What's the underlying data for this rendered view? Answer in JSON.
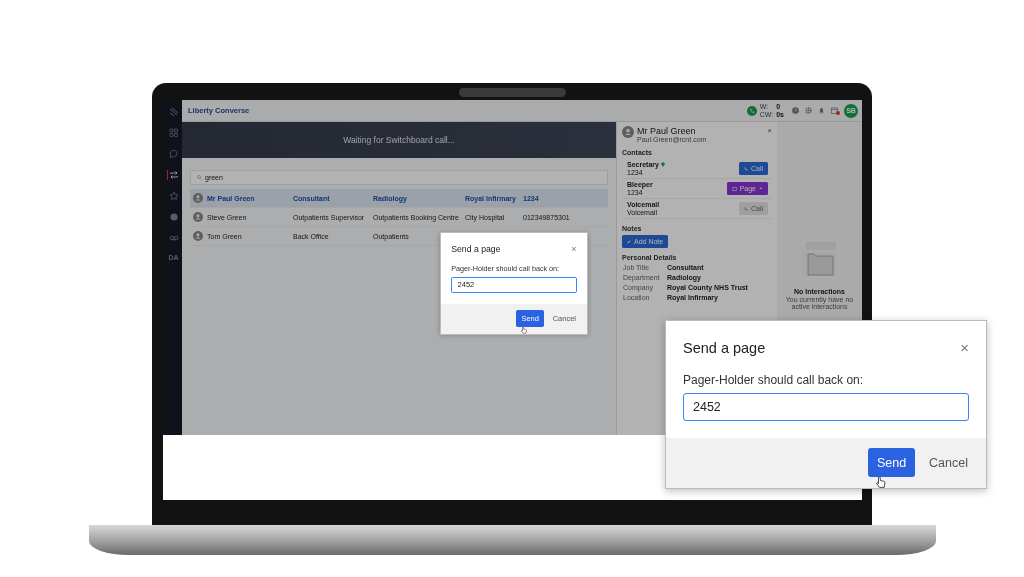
{
  "app": {
    "title": "Liberty Converse",
    "user_initials": "SB",
    "has_notification": true
  },
  "sidebar": {
    "items": [
      {
        "kind": "logo",
        "selected": false
      },
      {
        "kind": "apps",
        "selected": false
      },
      {
        "kind": "chat",
        "selected": false
      },
      {
        "kind": "transfer",
        "selected": true
      },
      {
        "kind": "star",
        "selected": false
      },
      {
        "kind": "status",
        "selected": false
      },
      {
        "kind": "voicemail",
        "selected": false
      },
      {
        "kind": "text",
        "label": "DA",
        "selected": false
      }
    ]
  },
  "stats": [
    {
      "label": "W:",
      "value": "0"
    },
    {
      "label": "CW:",
      "value": "0s"
    }
  ],
  "banner": "Waiting for Switchboard call...",
  "search": {
    "value": "green"
  },
  "results": [
    {
      "name": "Mr Paul Green",
      "role": "Consultant",
      "department": "Radiology",
      "site": "Royal Infirmary",
      "phone": "1234",
      "selected": true
    },
    {
      "name": "Steve Green",
      "role": "Outpatients Supervisor",
      "department": "Outpatients Booking Centre",
      "site": "City Hospital",
      "phone": "012349875301",
      "selected": false
    },
    {
      "name": "Tom Green",
      "role": "Back Office",
      "department": "Outpatients",
      "selected": false
    }
  ],
  "contact": {
    "name": "Mr Paul Green",
    "email": "Paul.Green@rcnt.com",
    "close": "×",
    "contacts_heading": "Contacts",
    "contacts": [
      {
        "kind": "call",
        "label": "Secretary",
        "value": "1234",
        "available": true,
        "button": "Call",
        "disabled": false
      },
      {
        "kind": "page",
        "label": "Bleeper",
        "value": "1234",
        "available": false,
        "button": "Page",
        "disabled": false
      },
      {
        "kind": "call",
        "label": "Voicemail",
        "value": "Voicemail",
        "available": false,
        "button": "Call",
        "disabled": true
      }
    ],
    "notes_heading": "Notes",
    "add_note": "Add Note",
    "details_heading": "Personal Details",
    "details": [
      {
        "label": "Job Title",
        "value": "Consultant"
      },
      {
        "label": "Department",
        "value": "Radiology"
      },
      {
        "label": "Company",
        "value": "Royal County NHS Trust"
      },
      {
        "label": "Location",
        "value": "Royal Infirmary"
      }
    ]
  },
  "interactions": {
    "title": "No Interactions",
    "message": "You currently have no active interactions"
  },
  "dialog": {
    "title": "Send a page",
    "close": "×",
    "label": "Pager-Holder should call back on:",
    "value": "2452",
    "send": "Send",
    "cancel": "Cancel"
  },
  "magnified_dialog": {
    "title": "Send a page",
    "close": "×",
    "label": "Pager-Holder should call back on:",
    "value": "2452",
    "send": "Send",
    "cancel": "Cancel"
  }
}
